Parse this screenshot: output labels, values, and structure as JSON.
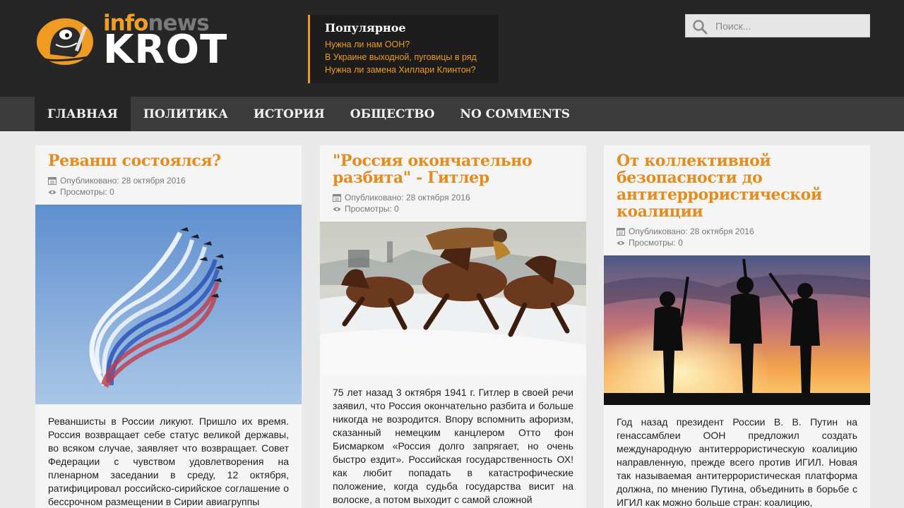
{
  "site": {
    "logo_top_a": "info",
    "logo_top_b": "news",
    "logo_main": "KROT"
  },
  "popular": {
    "title": "Популярное",
    "links": [
      "Нужна ли нам ООН?",
      "В Украине выходной, пуговицы в ряд",
      "Нужна ли замена Хиллари Клинтон?"
    ]
  },
  "search": {
    "placeholder": "Поиск..."
  },
  "nav": {
    "items": [
      "Главная",
      "Политика",
      "История",
      "Общество",
      "No comments"
    ],
    "active": "Главная"
  },
  "meta_labels": {
    "published_prefix": "Опубликовано:",
    "views_prefix": "Просмотры:"
  },
  "articles": [
    {
      "title": "Реванш состоялся?",
      "published": "Опубликовано: 28 октября 2016",
      "views": "Просмотры: 0",
      "image": "aerobatic-jets-tricolor-smoke",
      "text": "Реваншисты в России ликуют. Пришло их время. Россия возвращает себе статус великой державы, во всяком случае, заявляет что возвращает. Совет Федерации с чувством удовлетворения на пленарном заседании в среду, 12 октября, ратифицировал российско-сирийское соглашение о бессрочном размещении в Сирии авиагруппы"
    },
    {
      "title": "\"Россия окончательно разбита\" - Гитлер",
      "published": "Опубликовано: 28 октября 2016",
      "views": "Просмотры: 0",
      "image": "troika-horses-painting",
      "text": "75 лет назад 3 октября 1941 г. Гитлер в своей речи заявил, что Россия окончательно разбита и больше никогда не возродится. Впору вспомнить афоризм, сказанный немецким канцлером Отто фон Бисмарком «Россия долго запрягает, но очень быстро ездит». Российская государственность ОХ! как любит попадать в катастрофические положение, когда судьба государства висит на волоске, а потом выходит с самой сложной"
    },
    {
      "title": "От коллективной безопасности до антитеррористической коалиции",
      "published": "Опубликовано: 28 октября 2016",
      "views": "Просмотры: 0",
      "image": "soldiers-silhouette-sunset",
      "text": "Год назад президент России В. В. Путин на генассамблеи ООН предложил создать международную антитеррористическую коалицию направленную, прежде всего против ИГИЛ. Новая так называемая антитеррористическая платформа должна, по мнению Путина, объединить в борьбе с ИГИЛ как можно больше стран: коалицию,"
    }
  ],
  "colors": {
    "accent": "#e48c1e",
    "header_bg": "#262626",
    "nav_bg": "#3b3b3b"
  }
}
